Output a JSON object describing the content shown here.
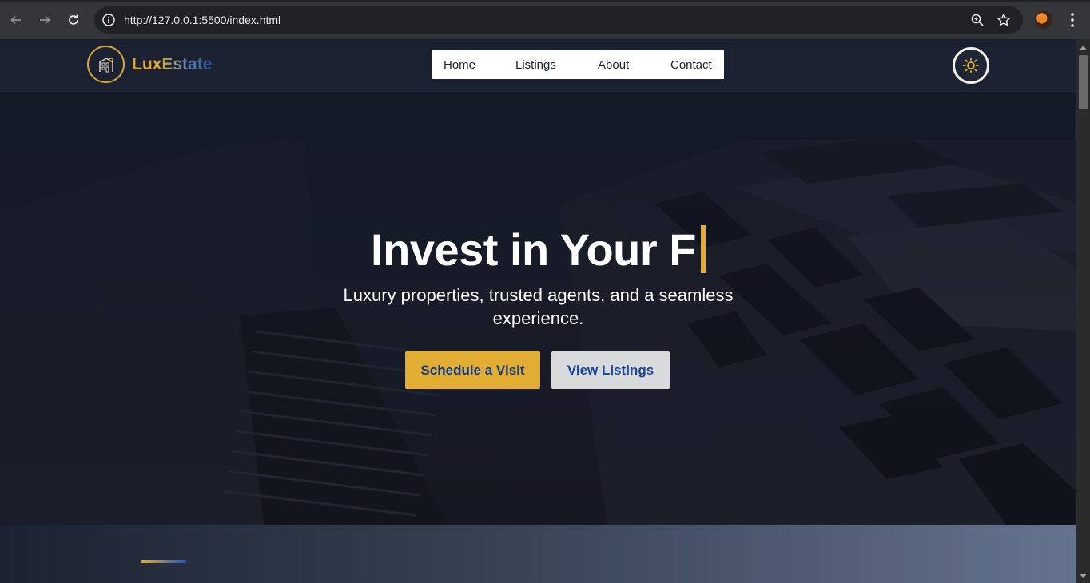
{
  "browser": {
    "url": "http://127.0.0.1:5500/index.html",
    "icons": [
      "back-arrow-icon",
      "forward-arrow-icon",
      "reload-icon",
      "site-info-icon",
      "zoom-icon",
      "bookmark-star-icon",
      "profile-avatar",
      "menu-kebab-icon"
    ]
  },
  "site": {
    "logo_part1": "Lux",
    "logo_part2": "Estate",
    "nav": [
      "Home",
      "Listings",
      "About",
      "Contact"
    ],
    "theme_toggle_icon": "sun-icon"
  },
  "hero": {
    "title": "Invest in Your F",
    "subtitle": "Luxury properties, trusted agents, and a seamless experience.",
    "primary_button": "Schedule a Visit",
    "secondary_button": "View Listings"
  },
  "colors": {
    "accent_gold": "#e1ad33",
    "accent_blue": "#1a46a0",
    "header_bg": "#1b2130"
  }
}
